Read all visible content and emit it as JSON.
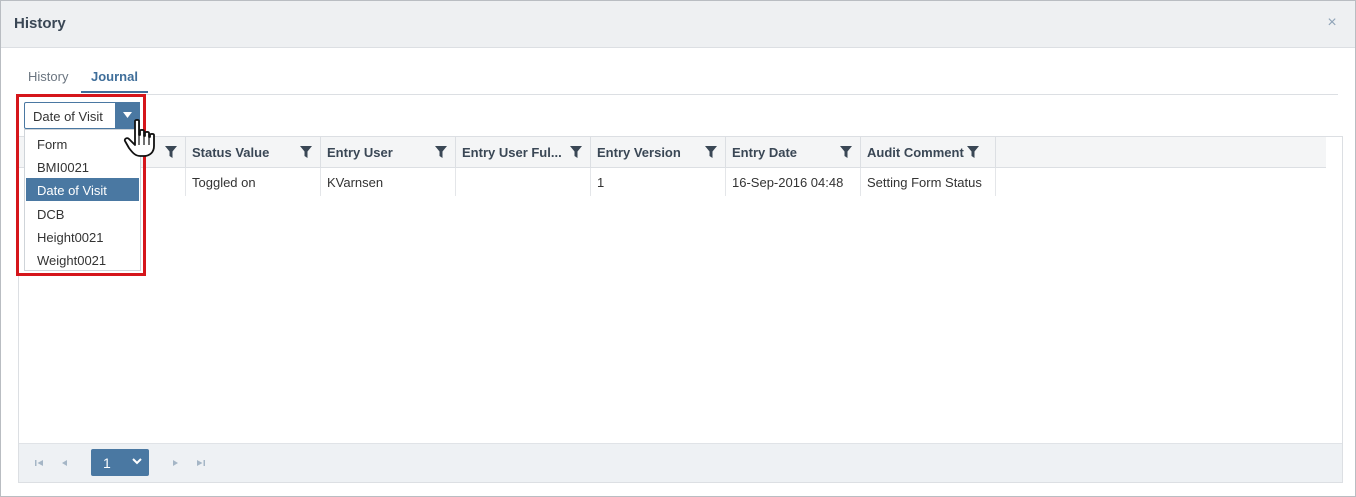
{
  "dialog": {
    "title": "History",
    "close_glyph": "×"
  },
  "tabs": [
    {
      "label": "History",
      "active": false
    },
    {
      "label": "Journal",
      "active": true
    }
  ],
  "field_select": {
    "value": "Date of Visit",
    "options": [
      "Form",
      "BMI0021",
      "Date of Visit",
      "DCB",
      "Height0021",
      "Weight0021"
    ],
    "selected_index": 2
  },
  "grid": {
    "columns": [
      {
        "label": ""
      },
      {
        "label": "Status Value"
      },
      {
        "label": "Entry User"
      },
      {
        "label": "Entry User Ful..."
      },
      {
        "label": "Entry Version"
      },
      {
        "label": "Entry Date"
      },
      {
        "label": "Audit Comment"
      }
    ],
    "rows": [
      [
        "",
        "Toggled on",
        "KVarnsen",
        "",
        "1",
        "16-Sep-2016 04:48",
        "Setting Form Status"
      ]
    ]
  },
  "pager": {
    "page": "1"
  },
  "colors": {
    "accent": "#4a78a2",
    "highlight": "#d5161b"
  }
}
